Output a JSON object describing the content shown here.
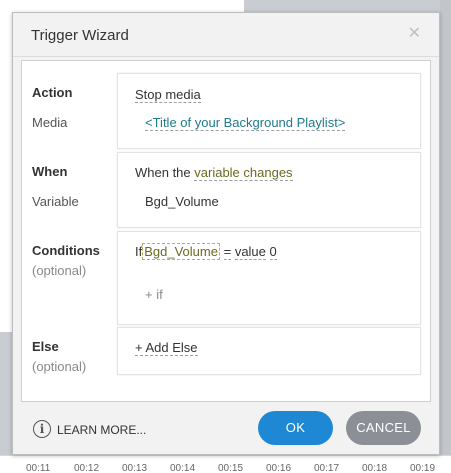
{
  "dialog": {
    "title": "Trigger Wizard",
    "close_glyph": "✕"
  },
  "action": {
    "label": "Action",
    "value": "Stop media",
    "media_label": "Media",
    "media_value": "<Title of your Background Playlist>"
  },
  "when": {
    "label": "When",
    "prefix": "When the ",
    "value": "variable changes",
    "variable_label": "Variable",
    "variable_value": "Bgd_Volume"
  },
  "conditions": {
    "label": "Conditions",
    "optional": "(optional)",
    "if_word": "If",
    "variable": "Bgd_Volume",
    "operator": "=",
    "value_word": "value",
    "value": "0",
    "add_if": "+ if"
  },
  "else": {
    "label": "Else",
    "optional": "(optional)",
    "add_else": "+ Add Else"
  },
  "footer": {
    "info_glyph": "i",
    "learn_more": "LEARN MORE...",
    "ok": "OK",
    "cancel": "CANCEL"
  },
  "timeline": {
    "ticks": [
      "00:11",
      "00:12",
      "00:13",
      "00:14",
      "00:15",
      "00:16",
      "00:17",
      "00:18",
      "00:19"
    ]
  },
  "colors": {
    "ok_button": "#1e88d4",
    "cancel_button": "#8c9096",
    "link_teal": "#1f7a8c",
    "link_olive": "#6b6a1f"
  }
}
